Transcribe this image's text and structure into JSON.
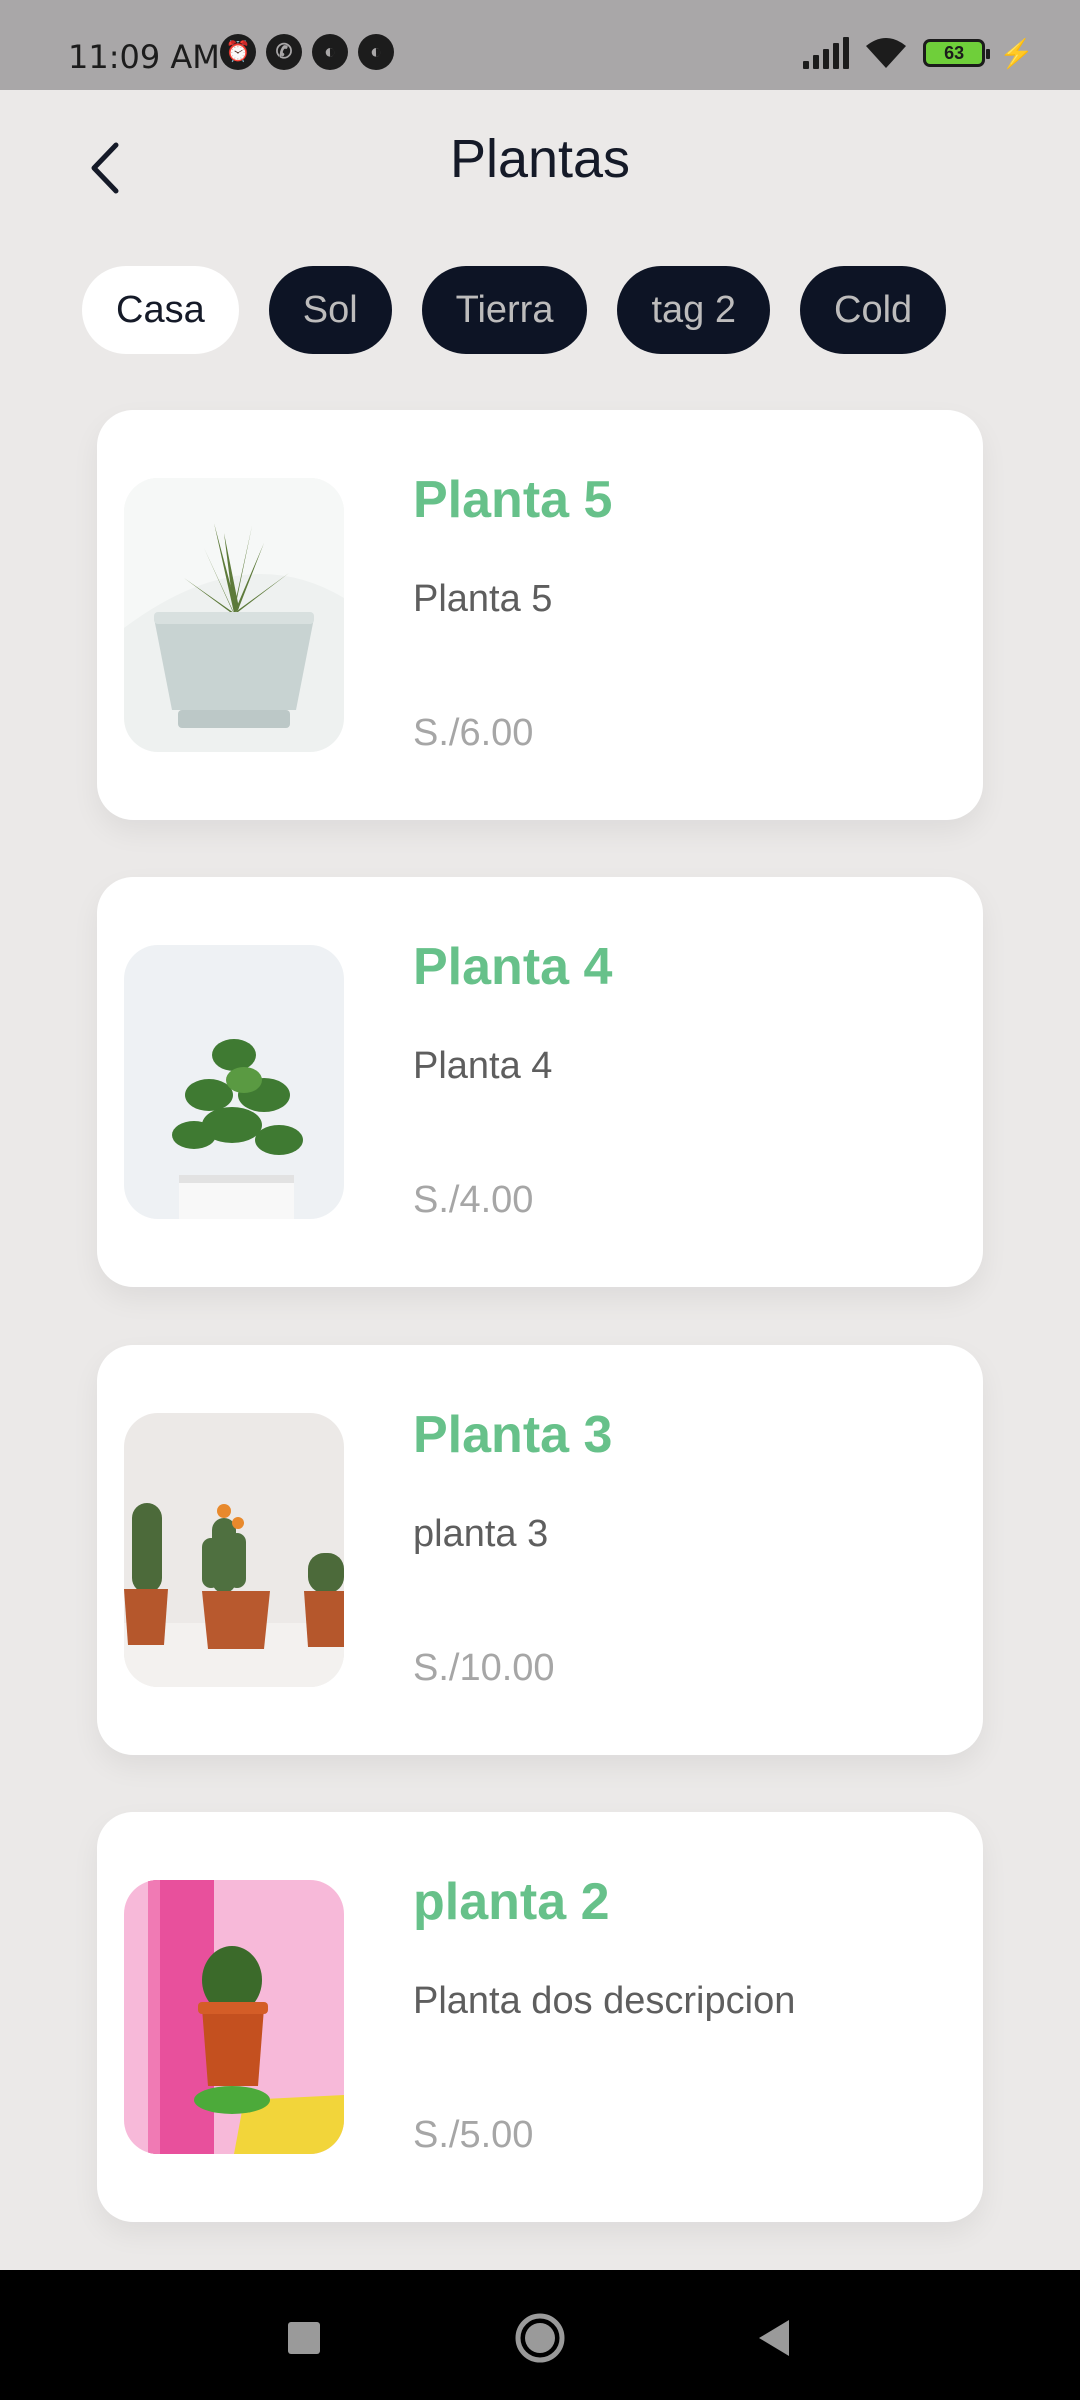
{
  "status_bar": {
    "time": "11:09 AM",
    "left_icons": [
      "alarm-icon",
      "whatsapp-icon",
      "app-icon",
      "app-icon"
    ],
    "battery_level": "63",
    "right_icons": [
      "signal-icon",
      "wifi-icon",
      "battery-icon",
      "charging-icon"
    ]
  },
  "header": {
    "title": "Plantas",
    "back_icon": "chevron-left-icon"
  },
  "tags": [
    {
      "label": "Casa",
      "active": true
    },
    {
      "label": "Sol",
      "active": false
    },
    {
      "label": "Tierra",
      "active": false
    },
    {
      "label": "tag 2",
      "active": false
    },
    {
      "label": "Cold",
      "active": false
    }
  ],
  "products": [
    {
      "name": "Planta 5",
      "description": "Planta 5",
      "price": "S./6.00"
    },
    {
      "name": "Planta 4",
      "description": "Planta 4",
      "price": "S./4.00"
    },
    {
      "name": "Planta 3",
      "description": "planta 3",
      "price": "S./10.00"
    },
    {
      "name": "planta 2",
      "description": "Planta dos descripcion",
      "price": "S./5.00"
    }
  ],
  "colors": {
    "accent": "#67c18a",
    "tag_dark": "#0d1425",
    "background": "#ebe9e8"
  },
  "nav": [
    "recent-apps-icon",
    "home-icon",
    "back-icon"
  ]
}
